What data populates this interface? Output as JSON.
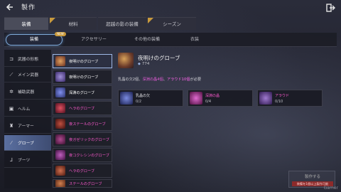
{
  "header": {
    "title": "製作"
  },
  "category_tabs": [
    {
      "label": "装備",
      "active": true,
      "corner": false
    },
    {
      "label": "材料",
      "active": false,
      "corner": true
    },
    {
      "label": "超越の影の装備",
      "active": false,
      "corner": false
    },
    {
      "label": "シーズン",
      "active": false,
      "corner": true
    }
  ],
  "sub_tabs": [
    {
      "label": "装備",
      "active": true
    },
    {
      "label": "アクセサリー",
      "active": false
    },
    {
      "label": "その他の装備",
      "active": false
    },
    {
      "label": "衣装",
      "active": false
    }
  ],
  "sub_tab_badge": "NEW",
  "sidebar": {
    "items": [
      {
        "label": "武器の形態",
        "icon": "weapon-icon"
      },
      {
        "label": "メイン武器",
        "icon": "sword-icon"
      },
      {
        "label": "補助武器",
        "icon": "gear-shield-icon"
      },
      {
        "label": "ヘルム",
        "icon": "helm-icon"
      },
      {
        "label": "アーマー",
        "icon": "armor-icon"
      },
      {
        "label": "グローブ",
        "icon": "glove-icon",
        "active": true
      },
      {
        "label": "ブーツ",
        "icon": "boots-icon"
      }
    ]
  },
  "item_list": [
    {
      "label": "夜明けのグローブ",
      "color": "#ffffff",
      "thumb": "#b06a3a",
      "active": true
    },
    {
      "label": "夜明けのグローブ",
      "color": "#ffffff",
      "thumb": "#6a5aa8"
    },
    {
      "label": "深淵のグローブ",
      "color": "#ffffff",
      "thumb": "#4a5ac8"
    },
    {
      "label": "ヘラのグローブ",
      "color": "#ff5ad0",
      "thumb": "#a02a3a"
    },
    {
      "label": "夜ステールのグローブ",
      "color": "#ff5ad0",
      "thumb": "#8a2a2a"
    },
    {
      "label": "夜ガゼリックのグローブ",
      "color": "#ff5ad0",
      "thumb": "#6a2a5a"
    },
    {
      "label": "夜コクレシンのグローブ",
      "color": "#ff5ad0",
      "thumb": "#7a3a7a"
    },
    {
      "label": "ヘラのグローブ",
      "color": "#ff5ad0",
      "thumb": "#9a3a2a"
    },
    {
      "label": "ステールのグローブ",
      "color": "#ff5ad0",
      "thumb": "#8a4a2a"
    }
  ],
  "detail": {
    "name": "夜明けのグローブ",
    "count": "774",
    "desc_prefix": "乳晶の欠2個、",
    "desc_pink": "深淵の晶4個",
    "desc_mid": "、",
    "desc_mag": "アラウド10個",
    "desc_suffix": "が必要",
    "materials": [
      {
        "name": "乳晶の欠",
        "qty": "0/2",
        "color": "#e8e8ec",
        "thumb": "#5a6ac8"
      },
      {
        "name": "深淵の晶",
        "qty": "0/4",
        "color": "#ff5ad0",
        "thumb": "#c84ab8"
      },
      {
        "name": "アラウド",
        "qty": "0/10",
        "color": "#ff5ad0",
        "thumb": "#8a5ab8"
      }
    ]
  },
  "craft": {
    "label": "製作する",
    "warning": "装備を1個以上製作可能"
  },
  "watermark": "Gamer"
}
